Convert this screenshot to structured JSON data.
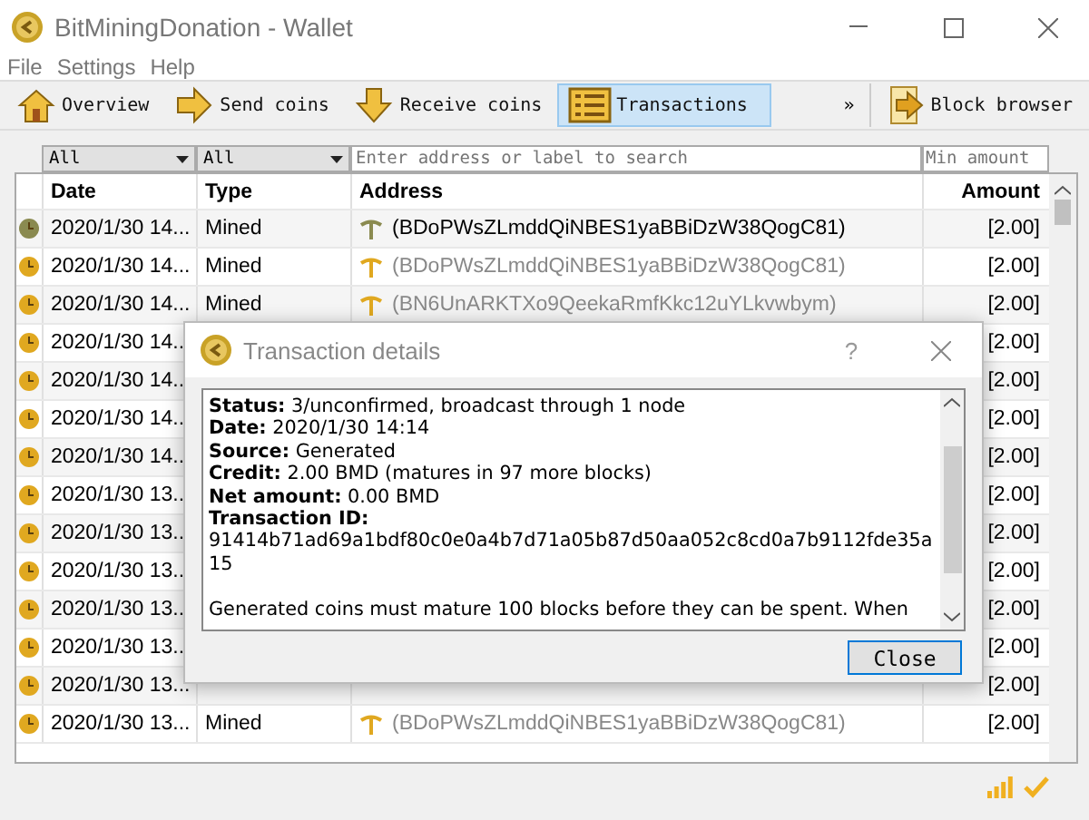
{
  "window": {
    "title": "BitMiningDonation - Wallet"
  },
  "menu": [
    "File",
    "Settings",
    "Help"
  ],
  "toolbar": [
    {
      "label": "Overview",
      "selected": false
    },
    {
      "label": "Send coins",
      "selected": false
    },
    {
      "label": "Receive coins",
      "selected": false
    },
    {
      "label": "Transactions",
      "selected": true
    }
  ],
  "toolbar_overflow": "»",
  "block_browser_button": "Block browser",
  "filters": {
    "date": "All",
    "type": "All",
    "search": {
      "placeholder": "Enter address or label to search"
    },
    "min_amount": {
      "placeholder": "Min amount"
    }
  },
  "table": {
    "columns": [
      "Date",
      "Type",
      "Address",
      "Amount"
    ],
    "rows": [
      {
        "color": "#8a8a50",
        "dimmed": false,
        "date": "2020/1/30 14...",
        "type": "Mined",
        "address": "(BDoPWsZLmddQiNBES1yaBBiDzW38QogC81)",
        "amount": "[2.00]"
      },
      {
        "color": "#e0a820",
        "dimmed": true,
        "date": "2020/1/30 14...",
        "type": "Mined",
        "address": "(BDoPWsZLmddQiNBES1yaBBiDzW38QogC81)",
        "amount": "[2.00]"
      },
      {
        "color": "#e0a820",
        "dimmed": true,
        "date": "2020/1/30 14...",
        "type": "Mined",
        "address": "(BN6UnARKTXo9QeekaRmfKkc12uYLkvwbym)",
        "amount": "[2.00]"
      },
      {
        "color": "#e0a820",
        "date": "2020/1/30 14..",
        "amount": "[2.00]"
      },
      {
        "color": "#e0a820",
        "date": "2020/1/30 14..",
        "amount": "[2.00]"
      },
      {
        "color": "#e0a820",
        "date": "2020/1/30 14..",
        "amount": "[2.00]"
      },
      {
        "color": "#e0a820",
        "date": "2020/1/30 14..",
        "amount": "[2.00]"
      },
      {
        "color": "#e0a820",
        "date": "2020/1/30 13..",
        "amount": "[2.00]"
      },
      {
        "color": "#e0a820",
        "date": "2020/1/30 13..",
        "amount": "[2.00]"
      },
      {
        "color": "#e0a820",
        "date": "2020/1/30 13..",
        "amount": "[2.00]"
      },
      {
        "color": "#e0a820",
        "date": "2020/1/30 13..",
        "amount": "[2.00]"
      },
      {
        "color": "#e0a820",
        "date": "2020/1/30 13..",
        "amount": "[2.00]"
      },
      {
        "color": "#e0a820",
        "date": "2020/1/30 13...",
        "amount": "[2.00]"
      },
      {
        "color": "#e0a820",
        "dimmed": true,
        "date": "2020/1/30 13...",
        "type": "Mined",
        "address": "(BDoPWsZLmddQiNBES1yaBBiDzW38QogC81)",
        "amount": "[2.00]"
      }
    ]
  },
  "dialog": {
    "title": "Transaction details",
    "help": "?",
    "lines": [
      "**Status:** 3/unconfirmed, broadcast through 1 node",
      "**Date:** 2020/1/30 14:14",
      "**Source:** Generated",
      "**Credit:** 2.00 BMD (matures in 97 more blocks)",
      "**Net amount:** 0.00 BMD",
      "**Transaction ID:**",
      "91414b71ad69a1bdf80c0e0a4b7d71a05b87d50aa052c8cd0a7b9112fde35a15"
    ],
    "note": "Generated coins must mature 100 blocks before they can be spent. When",
    "close_button": "Close"
  }
}
